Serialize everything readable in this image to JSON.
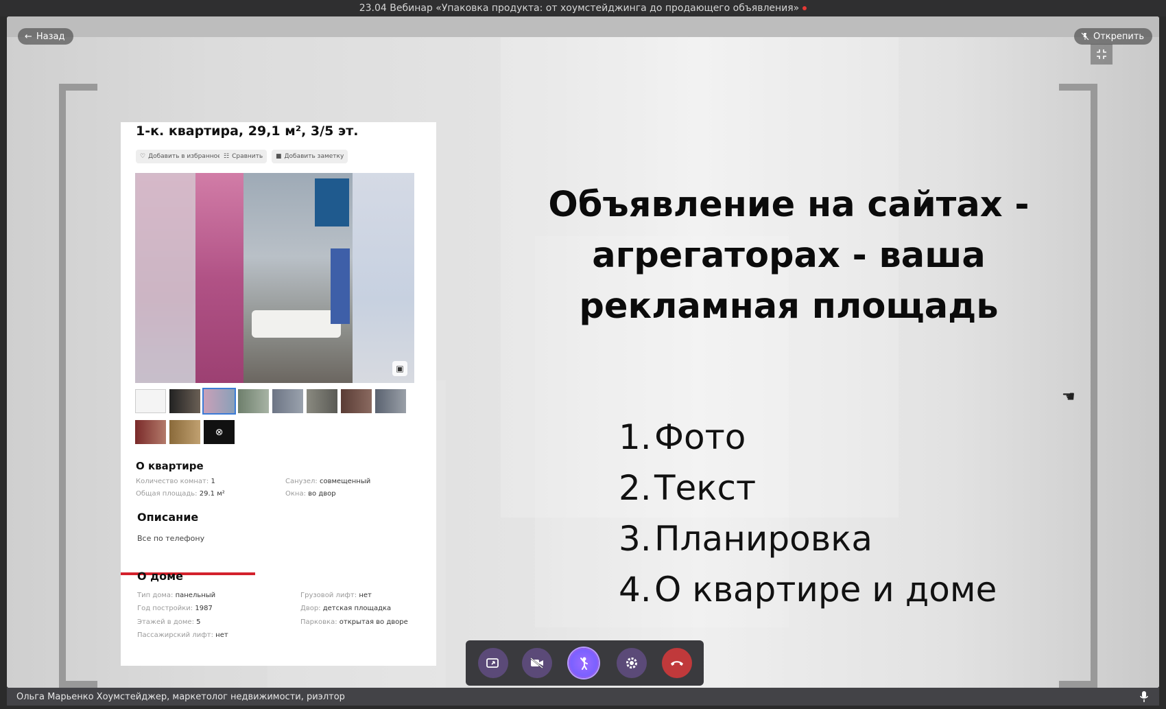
{
  "window": {
    "title": "23.04 Вебинар «Упаковка продукта: от хоумстейджинга до продающего объявления»"
  },
  "controls": {
    "back_label": "Назад",
    "unpin_label": "Открепить"
  },
  "listing": {
    "title": "1-к. квартира, 29,1 м², 3/5 эт.",
    "chips": [
      "Добавить в избранное",
      "Сравнить",
      "Добавить заметку"
    ],
    "about_flat_heading": "О квартире",
    "about_flat": [
      {
        "key": "Количество комнат:",
        "value": "1"
      },
      {
        "key": "Общая площадь:",
        "value": "29.1 м²"
      },
      {
        "key": "Санузел:",
        "value": "совмещенный"
      },
      {
        "key": "Окна:",
        "value": "во двор"
      }
    ],
    "description_heading": "Описание",
    "description_text": "Все по телефону",
    "about_house_heading": "О доме",
    "about_house": [
      {
        "key": "Тип дома:",
        "value": "панельный"
      },
      {
        "key": "Год постройки:",
        "value": "1987"
      },
      {
        "key": "Этажей в доме:",
        "value": "5"
      },
      {
        "key": "Пассажирский лифт:",
        "value": "нет"
      },
      {
        "key": "Грузовой лифт:",
        "value": "нет"
      },
      {
        "key": "Двор:",
        "value": "детская площадка"
      },
      {
        "key": "Парковка:",
        "value": "открытая во дворе"
      }
    ]
  },
  "slide": {
    "title_lines": [
      "Объявление на сайтах -",
      "агрегаторах - ваша",
      "рекламная площадь"
    ],
    "list": [
      {
        "num": "1.",
        "text": "Фото"
      },
      {
        "num": "2.",
        "text": "Текст"
      },
      {
        "num": "3.",
        "text": "Планировка"
      },
      {
        "num": "4.",
        "text": "О квартире и доме"
      }
    ]
  },
  "toolbar": {
    "buttons": [
      "screen-share",
      "camera-off",
      "raise-hand",
      "settings",
      "hang-up"
    ],
    "colors": {
      "default": "#5b4a78",
      "active": "#7b61ff",
      "hangup": "#c0393b"
    }
  },
  "speaker": {
    "name": "Ольга Марьенко Хоумстейджер, маркетолог недвижимости, риэлтор"
  }
}
